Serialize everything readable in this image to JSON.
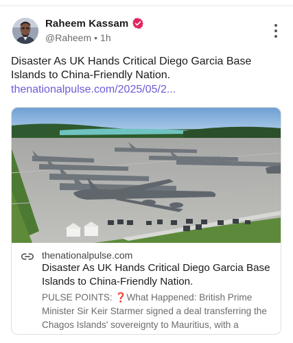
{
  "post": {
    "author_name": "Raheem Kassam",
    "handle": "@Raheem",
    "separator": "•",
    "time": "1h",
    "text": "Disaster As UK Hands Critical Diego Garcia Base Islands to China-Friendly Nation.",
    "link_text": "thenationalpulse.com/2025/05/2..."
  },
  "card": {
    "domain": "thenationalpulse.com",
    "title": "Disaster As UK Hands Critical Diego Garcia Base Islands to China-Friendly Nation.",
    "desc_prefix": "PULSE POINTS: ",
    "desc_mark": "❓",
    "desc_rest": "What Happened: British Prime Minister Sir Keir Starmer signed a deal transferring the Chagos Islands' sovereignty to Mauritius, with a"
  },
  "icons": {
    "verified": "verified-badge-icon",
    "more": "more-vertical-icon",
    "link": "link-icon"
  },
  "colors": {
    "verified_badge": "#e0245e",
    "link": "#6a5bd6",
    "text_primary": "#1a1a1a",
    "text_secondary": "#6b6b6b"
  }
}
